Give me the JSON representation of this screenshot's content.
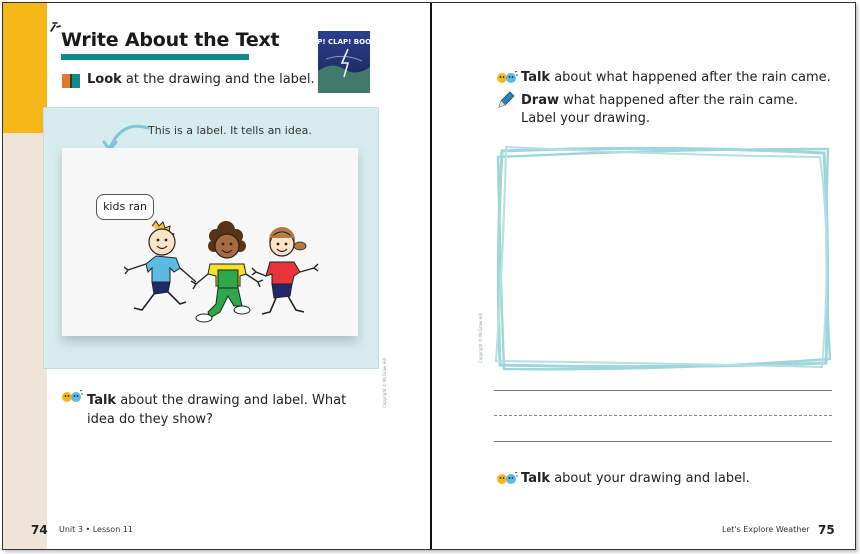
{
  "left_page": {
    "title": "Write About the Text",
    "book_cover_text": "ZAP! CLAP! BOOM!",
    "look_bold": "Look",
    "look_rest": " at the drawing and the label.",
    "label_note": "This is a label. It tells an idea.",
    "kids_label": "kids ran",
    "artist_credit": "Copyright © McGraw Hill",
    "talk_bold": "Talk",
    "talk_rest": " about the drawing and label. What idea do they show?",
    "page_number": "74",
    "footer": "Unit 3 • Lesson 11"
  },
  "right_page": {
    "talk1_bold": "Talk",
    "talk1_rest": " about what happened after the rain came.",
    "draw_bold": "Draw",
    "draw_rest": " what happened after the rain came.",
    "draw_line2": "Label your drawing.",
    "copyright": "Copyright © McGraw Hill",
    "talk2_bold": "Talk",
    "talk2_rest": " about your drawing and label.",
    "footer": "Let's Explore Weather",
    "page_number": "75"
  },
  "colors": {
    "accent_yellow": "#f7b718",
    "teal": "#0f8a8a",
    "peach": "#f0e3d8",
    "panel_blue": "#d7ecef",
    "frame_blue": "#9fd6dc"
  },
  "icons": [
    "book-icon",
    "talk-icon",
    "crayon-icon",
    "arrow-icon"
  ]
}
